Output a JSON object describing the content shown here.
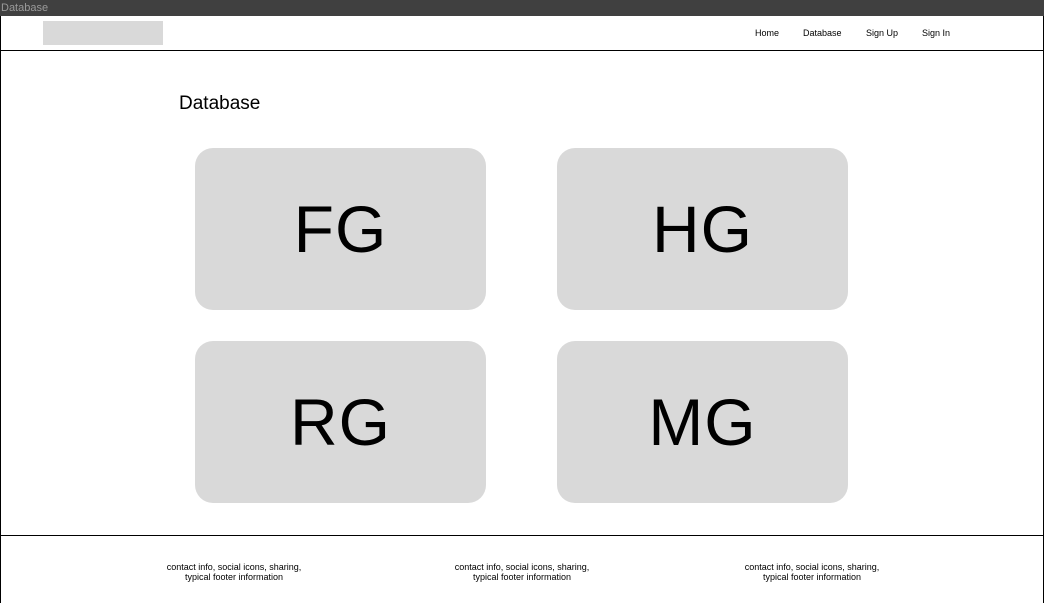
{
  "window": {
    "title": "Database"
  },
  "nav": {
    "items": [
      {
        "label": "Home"
      },
      {
        "label": "Database"
      },
      {
        "label": "Sign Up"
      },
      {
        "label": "Sign In"
      }
    ]
  },
  "main": {
    "heading": "Database",
    "cards": [
      {
        "label": "FG"
      },
      {
        "label": "HG"
      },
      {
        "label": "RG"
      },
      {
        "label": "MG"
      }
    ]
  },
  "footer": {
    "columns": [
      {
        "line1": "contact info, social icons, sharing,",
        "line2": "typical footer information"
      },
      {
        "line1": "contact info, social icons, sharing,",
        "line2": "typical footer information"
      },
      {
        "line1": "contact info, social icons, sharing,",
        "line2": "typical footer information"
      }
    ]
  }
}
